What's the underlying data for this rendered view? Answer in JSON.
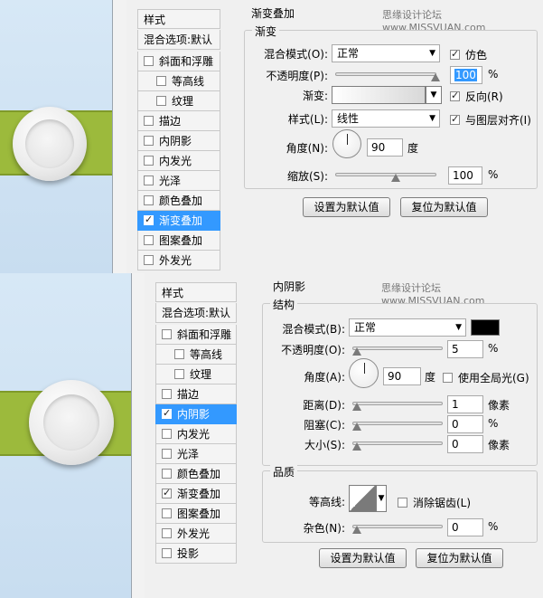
{
  "top": {
    "styles_header": "样式",
    "blend_defaults": "混合选项:默认",
    "items": [
      {
        "label": "斜面和浮雕",
        "checked": false,
        "indent": false
      },
      {
        "label": "等高线",
        "checked": false,
        "indent": true
      },
      {
        "label": "纹理",
        "checked": false,
        "indent": true
      },
      {
        "label": "描边",
        "checked": false,
        "indent": false
      },
      {
        "label": "内阴影",
        "checked": false,
        "indent": false
      },
      {
        "label": "内发光",
        "checked": false,
        "indent": false
      },
      {
        "label": "光泽",
        "checked": false,
        "indent": false
      },
      {
        "label": "颜色叠加",
        "checked": false,
        "indent": false
      },
      {
        "label": "渐变叠加",
        "checked": true,
        "indent": false,
        "active": true
      },
      {
        "label": "图案叠加",
        "checked": false,
        "indent": false
      },
      {
        "label": "外发光",
        "checked": false,
        "indent": false
      }
    ],
    "section_title": "渐变叠加",
    "watermark": "思缘设计论坛 www.MISSVUAN.com",
    "group_title": "渐变",
    "blend_mode_label": "混合模式(O):",
    "blend_mode_value": "正常",
    "dither_label": "仿色",
    "opacity_label": "不透明度(P):",
    "opacity_value": "100",
    "opacity_unit": "%",
    "gradient_label": "渐变:",
    "reverse_label": "反向(R)",
    "style_label": "样式(L):",
    "style_value": "线性",
    "align_label": "与图层对齐(I)",
    "angle_label": "角度(N):",
    "angle_value": "90",
    "angle_unit": "度",
    "scale_label": "缩放(S):",
    "scale_value": "100",
    "scale_unit": "%",
    "set_default": "设置为默认值",
    "reset_default": "复位为默认值"
  },
  "bottom": {
    "styles_header": "样式",
    "blend_defaults": "混合选项:默认",
    "items": [
      {
        "label": "斜面和浮雕",
        "checked": false,
        "indent": false
      },
      {
        "label": "等高线",
        "checked": false,
        "indent": true
      },
      {
        "label": "纹理",
        "checked": false,
        "indent": true
      },
      {
        "label": "描边",
        "checked": false,
        "indent": false
      },
      {
        "label": "内阴影",
        "checked": true,
        "indent": false,
        "active": true
      },
      {
        "label": "内发光",
        "checked": false,
        "indent": false
      },
      {
        "label": "光泽",
        "checked": false,
        "indent": false
      },
      {
        "label": "颜色叠加",
        "checked": false,
        "indent": false
      },
      {
        "label": "渐变叠加",
        "checked": true,
        "indent": false
      },
      {
        "label": "图案叠加",
        "checked": false,
        "indent": false
      },
      {
        "label": "外发光",
        "checked": false,
        "indent": false
      },
      {
        "label": "投影",
        "checked": false,
        "indent": false
      }
    ],
    "section_title": "内阴影",
    "watermark": "思缘设计论坛 www.MISSVUAN.com",
    "structure_title": "结构",
    "blend_mode_label": "混合模式(B):",
    "blend_mode_value": "正常",
    "opacity_label": "不透明度(O):",
    "opacity_value": "5",
    "opacity_unit": "%",
    "angle_label": "角度(A):",
    "angle_value": "90",
    "angle_unit": "度",
    "global_light_label": "使用全局光(G)",
    "distance_label": "距离(D):",
    "distance_value": "1",
    "distance_unit": "像素",
    "choke_label": "阻塞(C):",
    "choke_value": "0",
    "choke_unit": "%",
    "size_label": "大小(S):",
    "size_value": "0",
    "size_unit": "像素",
    "quality_title": "品质",
    "contour_label": "等高线:",
    "antialias_label": "消除锯齿(L)",
    "noise_label": "杂色(N):",
    "noise_value": "0",
    "noise_unit": "%",
    "set_default": "设置为默认值",
    "reset_default": "复位为默认值"
  }
}
